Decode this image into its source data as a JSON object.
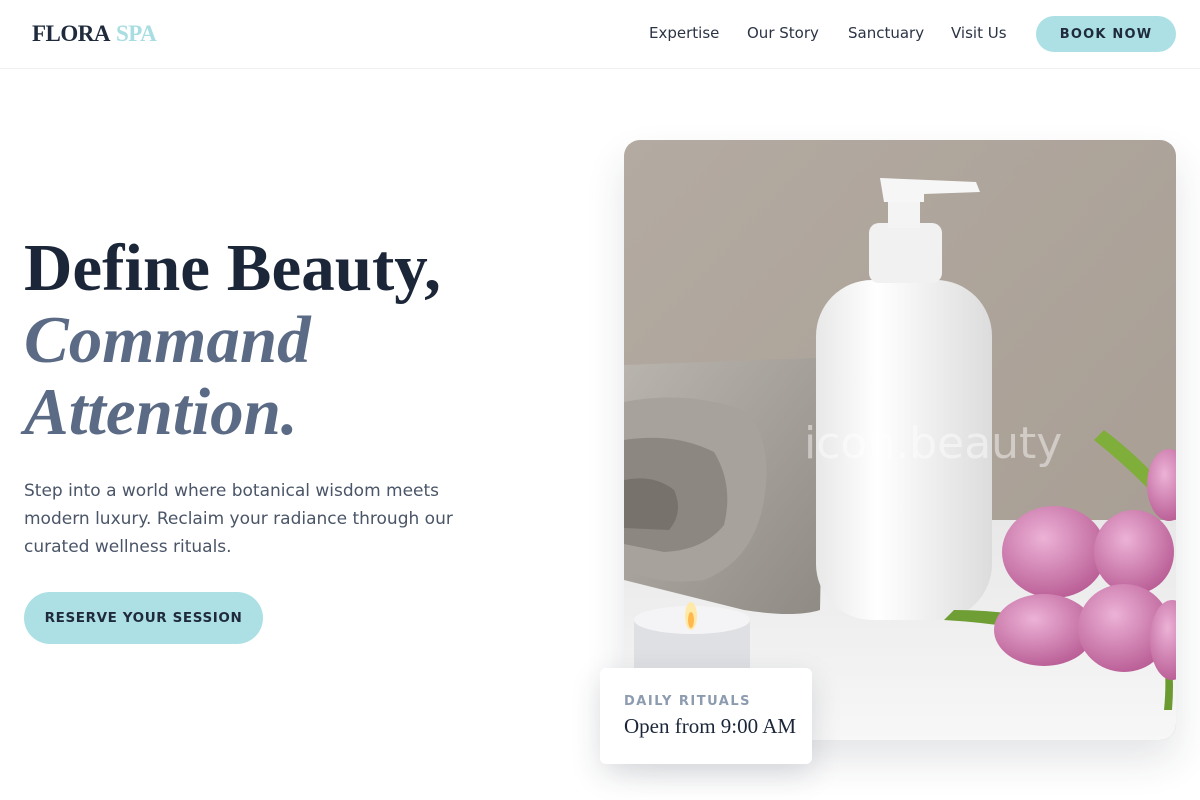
{
  "header": {
    "logo_primary": "FLORA",
    "logo_accent": "SPA",
    "nav": [
      {
        "label": "Expertise"
      },
      {
        "label": "Our Story"
      },
      {
        "label": "Sanctuary"
      },
      {
        "label": "Visit Us"
      }
    ],
    "book_label": "BOOK NOW"
  },
  "hero": {
    "headline_line1": "Define Beauty,",
    "headline_line2": "Command",
    "headline_line3": "Attention.",
    "subtext": "Step into a world where botanical wisdom meets modern luxury. Reclaim your radiance through our curated wellness rituals.",
    "cta_label": "RESERVE YOUR SESSION"
  },
  "image": {
    "watermark": "icon.beauty"
  },
  "info_card": {
    "eyebrow": "DAILY RITUALS",
    "value": "Open from 9:00 AM"
  },
  "colors": {
    "accent": "#ace0e4",
    "navy": "#1c2639",
    "slate": "#5b6b85"
  }
}
